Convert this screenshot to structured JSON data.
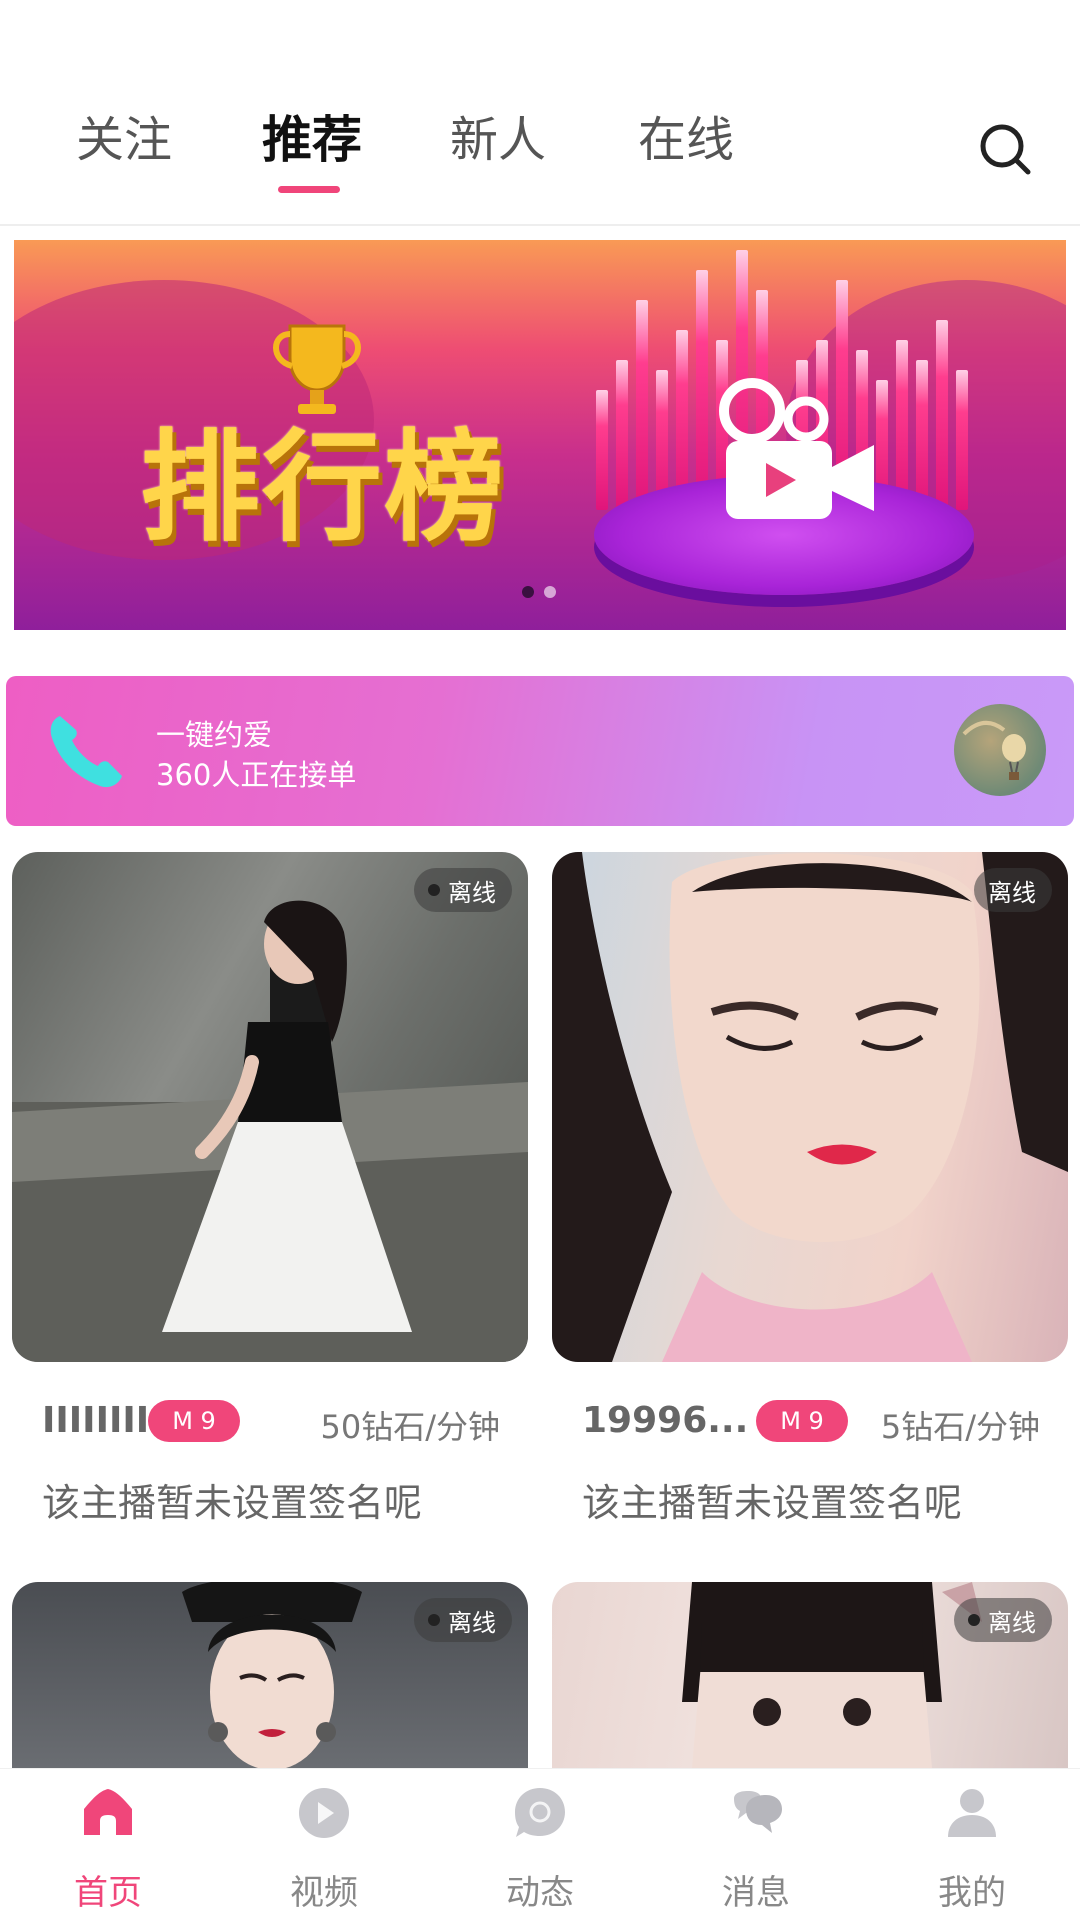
{
  "top_tabs": {
    "items": [
      {
        "label": "关注"
      },
      {
        "label": "推荐",
        "active": true
      },
      {
        "label": "新人"
      },
      {
        "label": "在线"
      }
    ],
    "search_icon": "search-icon"
  },
  "banner": {
    "title": "排行榜",
    "slide_count": 2,
    "active_slide": 1
  },
  "call_strip": {
    "line1": "一键约爱",
    "line2": "360人正在接单"
  },
  "cards": [
    {
      "status": "离线",
      "name": "IIIIIIII",
      "level": "M 9",
      "price": "50钻石/分钟",
      "signature": "该主播暂未设置签名呢"
    },
    {
      "status": "离线",
      "name": "19996...",
      "level": "M 9",
      "price": "5钻石/分钟",
      "signature": "该主播暂未设置签名呢"
    },
    {
      "status": "离线"
    },
    {
      "status": "离线"
    }
  ],
  "bottom_nav": [
    {
      "label": "首页",
      "icon": "home-icon",
      "active": true
    },
    {
      "label": "视频",
      "icon": "play-icon"
    },
    {
      "label": "动态",
      "icon": "moments-icon"
    },
    {
      "label": "消息",
      "icon": "message-icon"
    },
    {
      "label": "我的",
      "icon": "profile-icon"
    }
  ],
  "colors": {
    "accent": "#f0467a",
    "inactive": "#888888"
  }
}
